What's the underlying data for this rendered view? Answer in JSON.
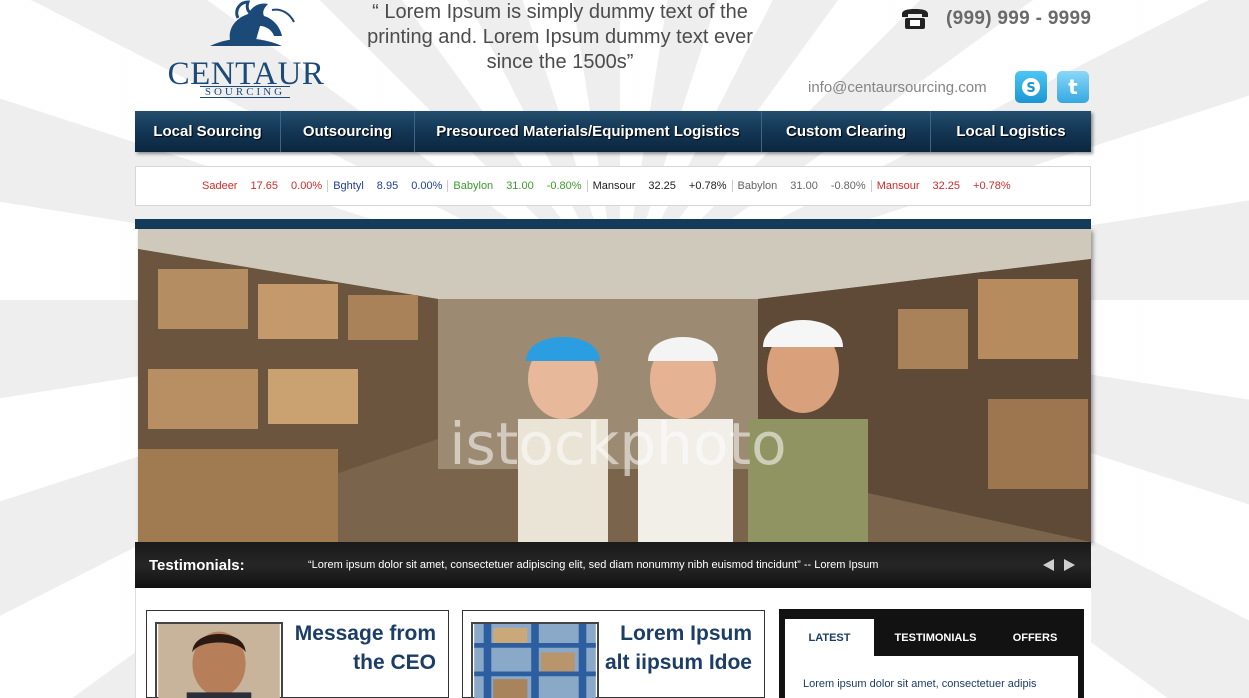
{
  "header": {
    "brand": "CENTAUR",
    "brand_sub": "SOURCING",
    "quote": "“ Lorem Ipsum is simply dummy text of the printing and. Lorem Ipsum dummy text ever since the 1500s”",
    "phone": "(999) 999 - 9999",
    "email": "info@centaursourcing.com",
    "social": [
      "skype-icon",
      "twitter-icon"
    ]
  },
  "nav": {
    "items": [
      {
        "label": "Local Sourcing"
      },
      {
        "label": "Outsourcing"
      },
      {
        "label": "Presourced Materials/Equipment Logistics"
      },
      {
        "label": "Custom Clearing"
      },
      {
        "label": "Local Logistics"
      }
    ]
  },
  "ticker": [
    {
      "name": "Sadeer",
      "price": "17.65",
      "change": "0.00%",
      "name_color": "#d42a2a",
      "value_color": "#d42a2a"
    },
    {
      "name": "Bghtyl",
      "price": "8.95",
      "change": "0.00%",
      "name_color": "#1f3f9a",
      "value_color": "#1f3f9a"
    },
    {
      "name": "Babylon",
      "price": "31.00",
      "change": "-0.80%",
      "name_color": "#3c9a2c",
      "value_color": "#3c9a2c"
    },
    {
      "name": "Mansour",
      "price": "32.25",
      "change": "+0.78%",
      "name_color": "#222222",
      "value_color": "#222222"
    },
    {
      "name": "Babylon",
      "price": "31.00",
      "change": "-0.80%",
      "name_color": "#666666",
      "value_color": "#666666"
    },
    {
      "name": "Mansour",
      "price": "32.25",
      "change": "+0.78%",
      "name_color": "#d42a2a",
      "value_color": "#d42a2a"
    }
  ],
  "hero": {
    "watermark": "istockphoto"
  },
  "testimonials": {
    "label": "Testimonials:",
    "text": "“Lorem ipsum dolor sit amet, consectetuer adipiscing elit, sed diam nonummy nibh euismod tincidunt” -- Lorem Ipsum"
  },
  "cards": [
    {
      "title": "Message from the CEO"
    },
    {
      "title": "Lorem Ipsum alt iipsum Idoe"
    }
  ],
  "tabs": {
    "items": [
      "LATEST",
      "TESTIMONIALS",
      "OFFERS"
    ],
    "content": "Lorem ipsum dolor sit amet, consectetuer adipis"
  },
  "colors": {
    "nav": "#133654",
    "brand": "#1c4a78",
    "title_blue": "#1b3d66"
  }
}
